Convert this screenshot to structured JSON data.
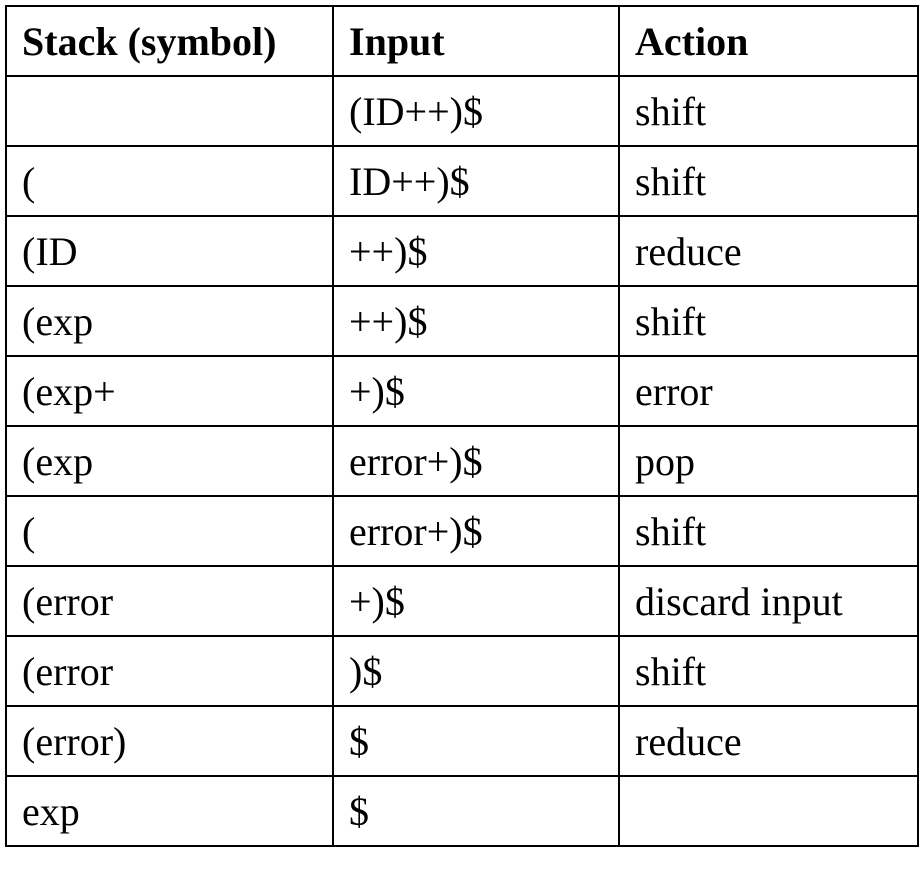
{
  "table": {
    "headers": [
      "Stack (symbol)",
      "Input",
      "Action"
    ],
    "rows": [
      [
        "",
        "(ID++)$",
        "shift"
      ],
      [
        "(",
        "ID++)$",
        "shift"
      ],
      [
        "(ID",
        "++)$",
        "reduce"
      ],
      [
        "(exp",
        "++)$",
        "shift"
      ],
      [
        "(exp+",
        "+)$",
        "error"
      ],
      [
        "(exp",
        "error+)$",
        "pop"
      ],
      [
        "(",
        "error+)$",
        "shift"
      ],
      [
        "(error",
        "+)$",
        "discard input"
      ],
      [
        "(error",
        ")$",
        "shift"
      ],
      [
        "(error)",
        "$",
        "reduce"
      ],
      [
        "exp",
        "$",
        ""
      ]
    ]
  }
}
